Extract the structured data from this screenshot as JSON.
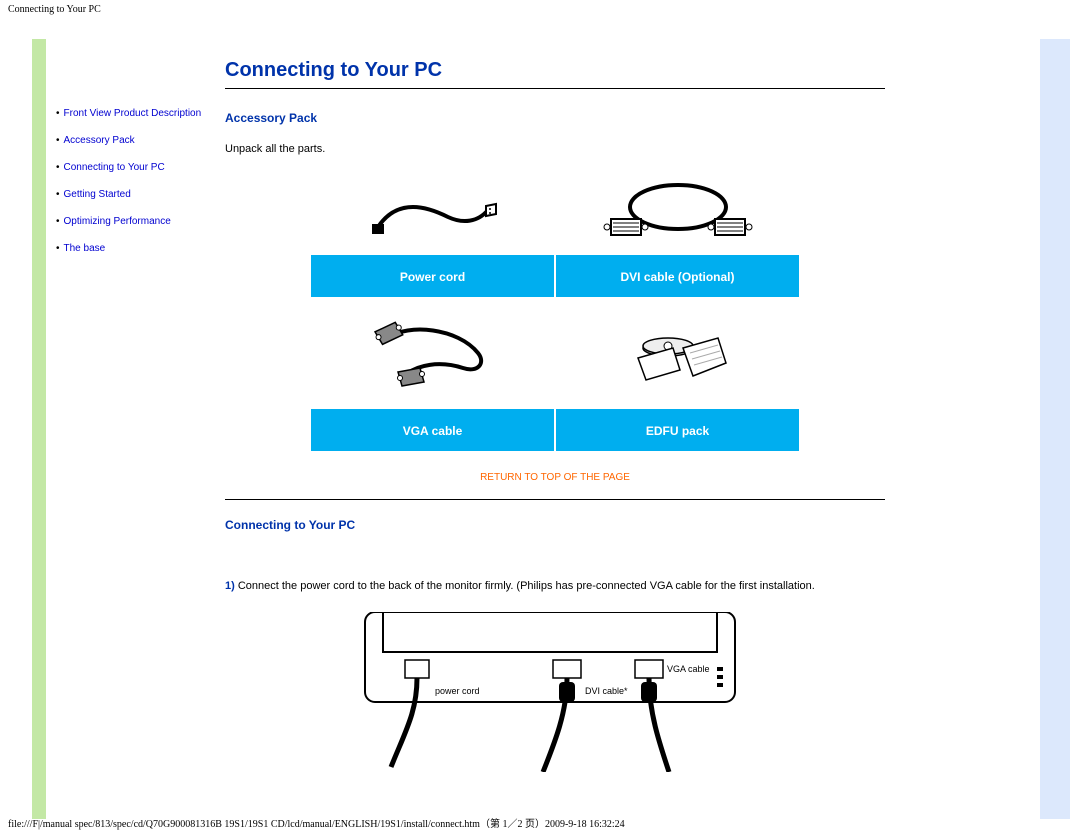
{
  "header": {
    "title": "Connecting to Your PC"
  },
  "sidebar": {
    "items": [
      {
        "label": "Front View Product Description"
      },
      {
        "label": "Accessory Pack"
      },
      {
        "label": "Connecting to Your PC"
      },
      {
        "label": "Getting Started"
      },
      {
        "label": "Optimizing Performance"
      },
      {
        "label": "The base"
      }
    ]
  },
  "content": {
    "page_title": "Connecting to Your PC",
    "accessory_heading": "Accessory Pack",
    "unpack_text": "Unpack all the parts.",
    "parts": {
      "power_cord": "Power cord",
      "dvi_cable": "DVI cable (Optional)",
      "vga_cable": "VGA cable",
      "edfu_pack": "EDFU pack"
    },
    "return_link": "RETURN TO TOP OF THE PAGE",
    "connecting_heading": "Connecting to Your PC",
    "step1_num": "1)",
    "step1_text": " Connect the power cord to the back of the monitor firmly. (Philips has pre-connected VGA cable for the first installation.",
    "monitor_labels": {
      "power": "power cord",
      "dvi": "DVI cable*",
      "vga": "VGA cable"
    }
  },
  "footer": {
    "path": "file:///F|/manual spec/813/spec/cd/Q70G900081316B 19S1/19S1 CD/lcd/manual/ENGLISH/19S1/install/connect.htm（第 1／2 页）2009-9-18 16:32:24"
  }
}
